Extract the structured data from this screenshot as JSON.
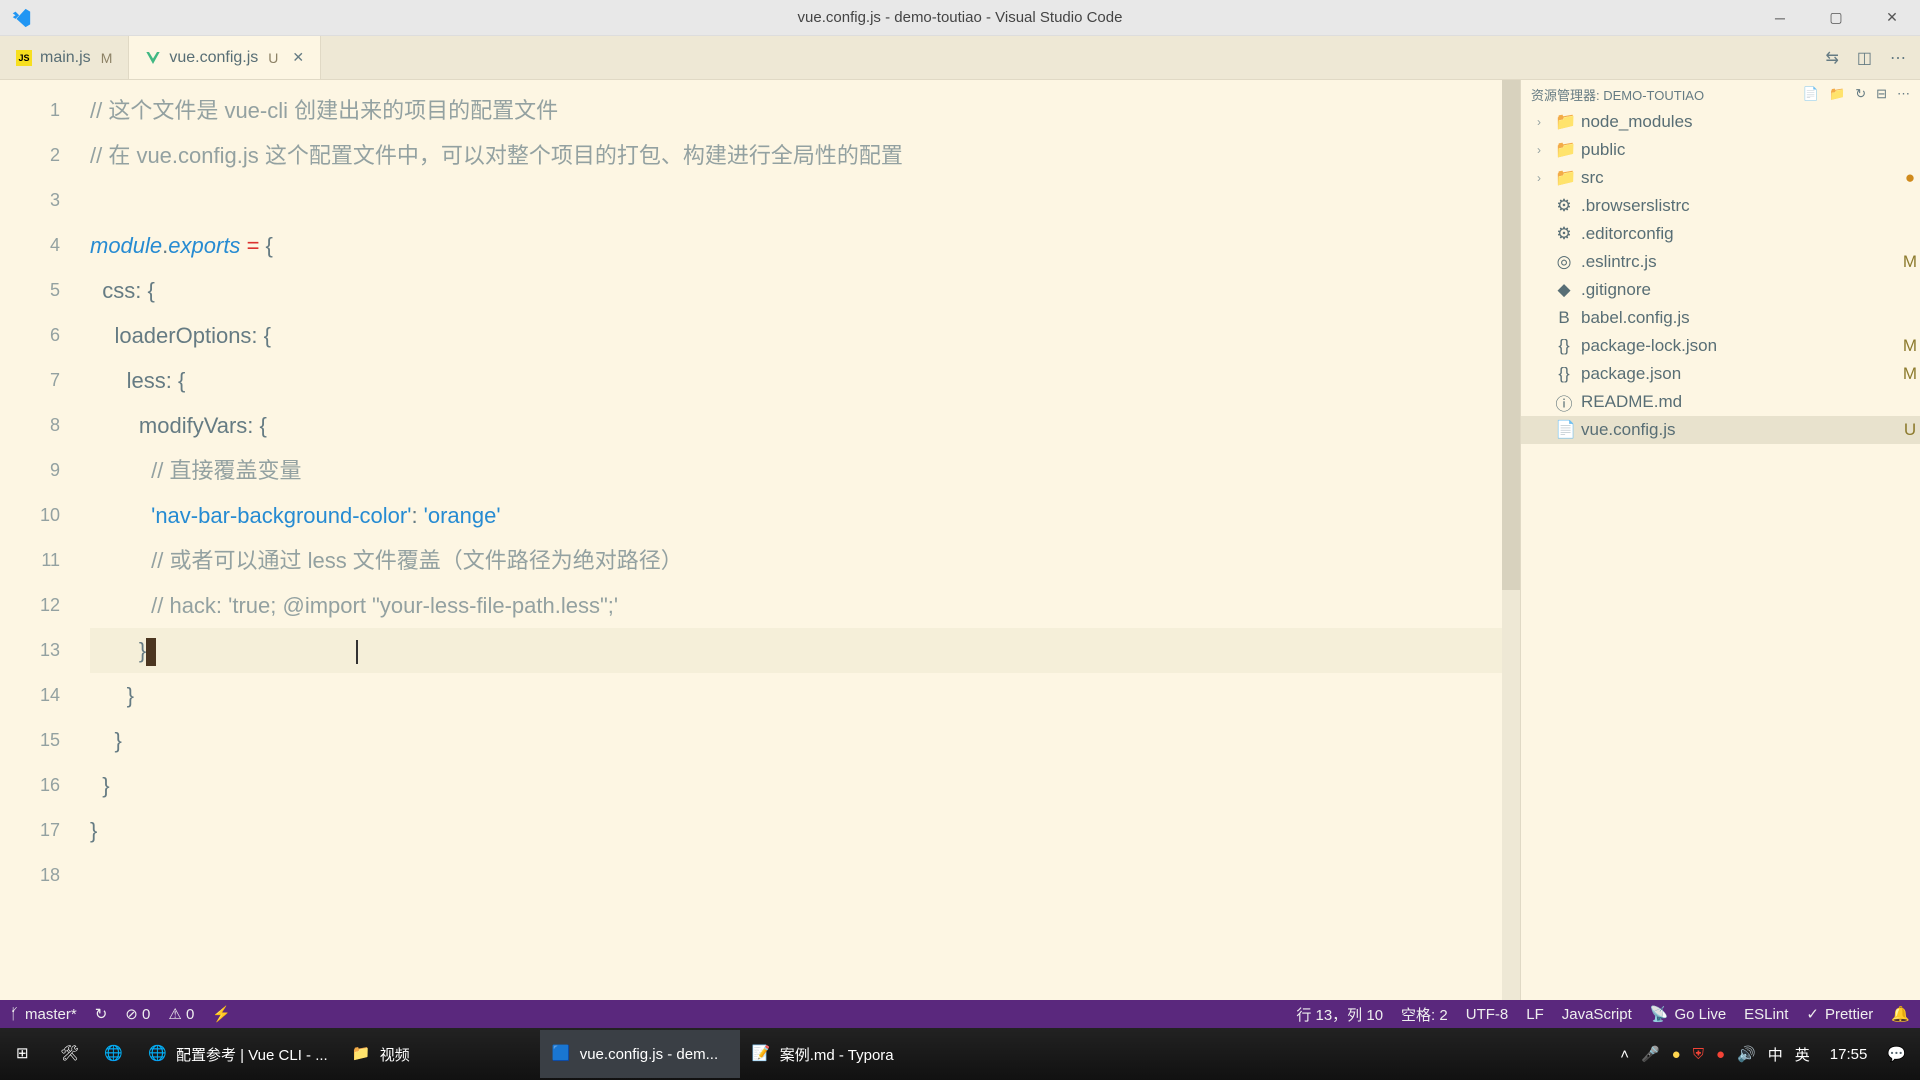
{
  "window": {
    "title": "vue.config.js - demo-toutiao - Visual Studio Code"
  },
  "tabs": [
    {
      "name": "main.js",
      "badge": "M",
      "active": false
    },
    {
      "name": "vue.config.js",
      "badge": "U",
      "active": true
    }
  ],
  "code": {
    "lines": [
      {
        "n": "1",
        "html": "<span class='comment'>// 这个文件是 vue-cli 创建出来的项目的配置文件</span>"
      },
      {
        "n": "2",
        "html": "<span class='comment'>// 在 vue.config.js 这个配置文件中，可以对整个项目的打包、构建进行全局性的配置</span>"
      },
      {
        "n": "3",
        "html": ""
      },
      {
        "n": "4",
        "html": "<span class='kw'>module</span>.<span class='kw'>exports</span> <span class='op'>=</span> {"
      },
      {
        "n": "5",
        "html": "  css: {"
      },
      {
        "n": "6",
        "html": "    loaderOptions: {"
      },
      {
        "n": "7",
        "html": "      less: {"
      },
      {
        "n": "8",
        "html": "        modifyVars: {"
      },
      {
        "n": "9",
        "html": "          <span class='comment'>// 直接覆盖变量</span>"
      },
      {
        "n": "10",
        "html": "          <span class='str'>'nav-bar-background-color'</span>: <span class='str'>'orange'</span>"
      },
      {
        "n": "11",
        "html": "          <span class='comment'>// 或者可以通过 less 文件覆盖（文件路径为绝对路径）</span>"
      },
      {
        "n": "12",
        "html": "          <span class='comment'>// hack: 'true; @import \"your-less-file-path.less\";'</span>"
      },
      {
        "n": "13",
        "html": "        }<span class='cursor'></span><span class='textcaret'></span>",
        "hl": true
      },
      {
        "n": "14",
        "html": "      }"
      },
      {
        "n": "15",
        "html": "    }"
      },
      {
        "n": "16",
        "html": "  }"
      },
      {
        "n": "17",
        "html": "}"
      },
      {
        "n": "18",
        "html": ""
      }
    ]
  },
  "explorer": {
    "title": "资源管理器: DEMO-TOUTIAO",
    "items": [
      {
        "type": "folder",
        "name": "node_modules",
        "arrow": "›",
        "color": "#4caf50"
      },
      {
        "type": "folder",
        "name": "public",
        "arrow": "›",
        "color": "#2196f3"
      },
      {
        "type": "folder",
        "name": "src",
        "arrow": "›",
        "color": "#4caf50",
        "statusDot": true
      },
      {
        "type": "file",
        "name": ".browserslistrc",
        "icon": "⚙"
      },
      {
        "type": "file",
        "name": ".editorconfig",
        "icon": "⚙"
      },
      {
        "type": "file",
        "name": ".eslintrc.js",
        "icon": "◎",
        "status": "M"
      },
      {
        "type": "file",
        "name": ".gitignore",
        "icon": "◆"
      },
      {
        "type": "file",
        "name": "babel.config.js",
        "icon": "B"
      },
      {
        "type": "file",
        "name": "package-lock.json",
        "icon": "{}",
        "status": "M"
      },
      {
        "type": "file",
        "name": "package.json",
        "icon": "{}",
        "status": "M"
      },
      {
        "type": "file",
        "name": "README.md",
        "icon": "ⓘ"
      },
      {
        "type": "file",
        "name": "vue.config.js",
        "icon": "📄",
        "status": "U",
        "selected": true
      }
    ]
  },
  "status": {
    "branch": "master*",
    "sync": "↻",
    "errors": "⊘ 0",
    "warnings": "⚠ 0",
    "bolt": "⚡",
    "pos": "行 13，列 10",
    "spaces": "空格: 2",
    "encoding": "UTF-8",
    "eol": "LF",
    "lang": "JavaScript",
    "golive": "Go Live",
    "eslint": "ESLint",
    "prettier": "Prettier"
  },
  "taskbar": {
    "items": [
      {
        "label": "",
        "icon": "win"
      },
      {
        "label": "",
        "icon": "app1"
      },
      {
        "label": "",
        "icon": "chrome"
      },
      {
        "label": "配置参考 | Vue CLI - ...",
        "icon": "chrome",
        "wide": true
      },
      {
        "label": "视频",
        "icon": "folder",
        "wide": true
      },
      {
        "label": "vue.config.js - dem...",
        "icon": "vsc",
        "wide": true,
        "active": true
      },
      {
        "label": "案例.md - Typora",
        "icon": "typora",
        "wide": true
      }
    ],
    "tray": {
      "ime1": "中",
      "ime2": "英",
      "time": "17:55"
    }
  }
}
